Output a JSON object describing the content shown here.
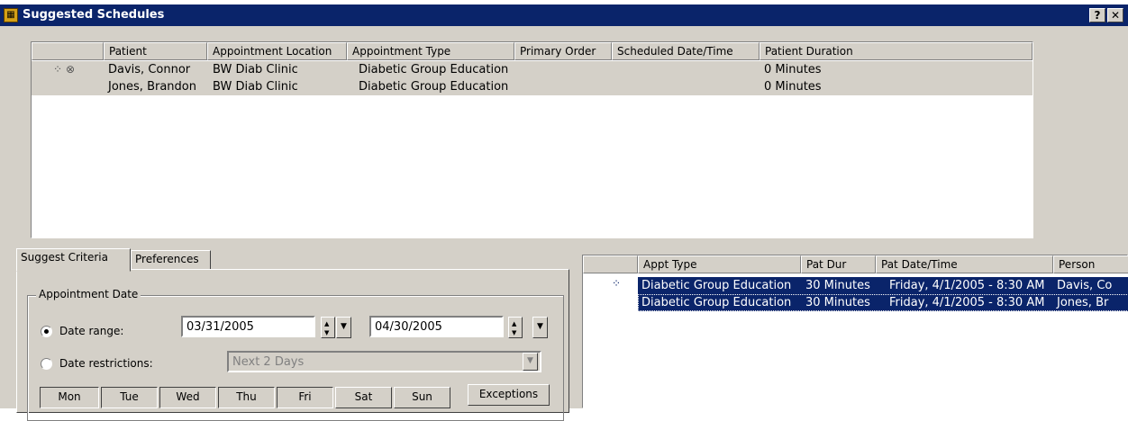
{
  "window": {
    "title": "Suggested Schedules",
    "help_label": "?",
    "close_label": "✕"
  },
  "top_grid": {
    "columns": [
      "",
      "Patient",
      "Appointment Location",
      "Appointment Type",
      "Primary Order",
      "Scheduled Date/Time",
      "Patient Duration"
    ],
    "rows": [
      {
        "patient": "Davis, Connor",
        "location": "BW Diab Clinic",
        "type": "Diabetic Group Education",
        "primary_order": "",
        "scheduled": "",
        "duration": "0 Minutes",
        "icons": [
          "grid-icon",
          "handshake-icon"
        ]
      },
      {
        "patient": "Jones, Brandon",
        "location": "BW Diab Clinic",
        "type": "Diabetic Group Education",
        "primary_order": "",
        "scheduled": "",
        "duration": "0 Minutes",
        "icons": []
      }
    ]
  },
  "tabs": {
    "suggest_criteria": "Suggest Criteria",
    "preferences": "Preferences"
  },
  "criteria": {
    "group_title": "Appointment Date",
    "date_range_label": "Date range:",
    "date_range_selected": true,
    "start_date": "03/31/2005",
    "end_date": "04/30/2005",
    "date_restrictions_label": "Date restrictions:",
    "date_restriction_value": "Next 2 Days",
    "days": [
      {
        "label": "Mon",
        "pressed": true
      },
      {
        "label": "Tue",
        "pressed": true
      },
      {
        "label": "Wed",
        "pressed": true
      },
      {
        "label": "Thu",
        "pressed": true
      },
      {
        "label": "Fri",
        "pressed": true
      },
      {
        "label": "Sat",
        "pressed": false
      },
      {
        "label": "Sun",
        "pressed": false
      }
    ],
    "exceptions_label": "Exceptions"
  },
  "results_grid": {
    "columns": [
      "",
      "Appt Type",
      "Pat Dur",
      "Pat Date/Time",
      "Person"
    ],
    "rows": [
      {
        "type": "Diabetic Group Education",
        "duration": "30 Minutes",
        "datetime": "Friday, 4/1/2005 - 8:30 AM",
        "person": "Davis, Co"
      },
      {
        "type": "Diabetic Group Education",
        "duration": "30 Minutes",
        "datetime": "Friday, 4/1/2005 - 8:30 AM",
        "person": "Jones, Br"
      }
    ]
  },
  "colors": {
    "titlebar": "#0a246a",
    "face": "#d4d0c8",
    "selection": "#0a246a"
  }
}
